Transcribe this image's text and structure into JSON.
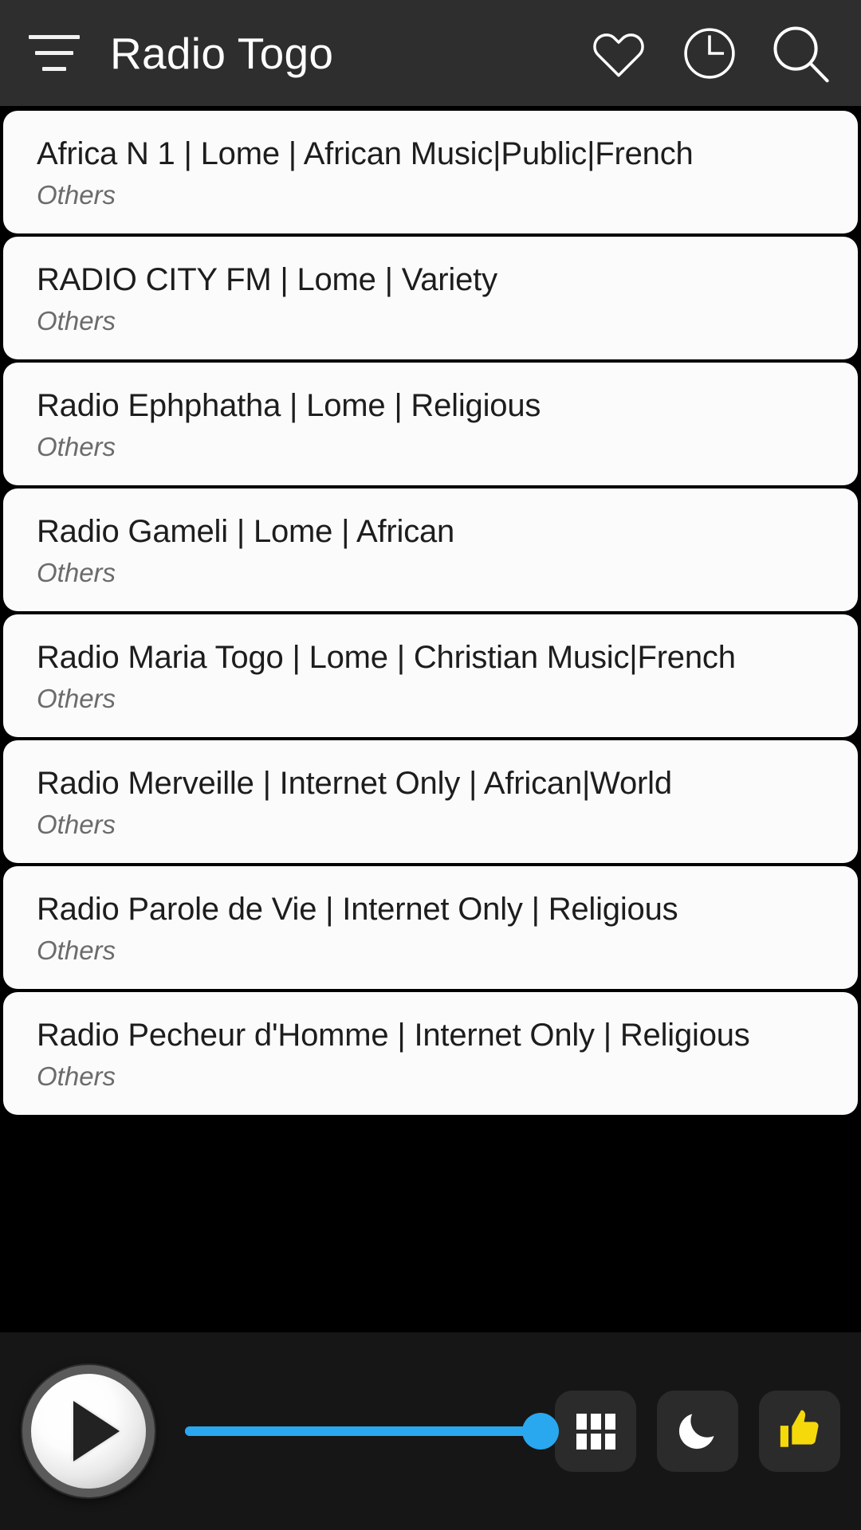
{
  "header": {
    "title": "Radio Togo",
    "menu_icon": "hamburger-menu-icon",
    "actions": [
      {
        "name": "favorites",
        "icon": "heart-icon"
      },
      {
        "name": "recent",
        "icon": "clock-icon"
      },
      {
        "name": "search",
        "icon": "search-icon"
      }
    ]
  },
  "stations": [
    {
      "name": "Africa N 1 | Lome | African Music|Public|French",
      "category": "Others"
    },
    {
      "name": "RADIO CITY FM | Lome | Variety",
      "category": "Others"
    },
    {
      "name": "Radio Ephphatha | Lome | Religious",
      "category": "Others"
    },
    {
      "name": "Radio Gameli | Lome | African",
      "category": "Others"
    },
    {
      "name": "Radio Maria Togo | Lome | Christian Music|French",
      "category": "Others"
    },
    {
      "name": "Radio Merveille | Internet Only | African|World",
      "category": "Others"
    },
    {
      "name": "Radio Parole de Vie | Internet Only | Religious",
      "category": "Others"
    },
    {
      "name": "Radio Pecheur d'Homme | Internet Only | Religious",
      "category": "Others"
    }
  ],
  "player": {
    "play_icon": "play-icon",
    "play_state": "paused",
    "volume": {
      "value": 100,
      "percent": "100%",
      "track_color": "#29a8ef",
      "thumb_color": "#29a8ef"
    },
    "buttons": [
      {
        "name": "equalizer",
        "icon": "grid-icon",
        "color": "#ffffff"
      },
      {
        "name": "sleep-timer",
        "icon": "moon-icon",
        "color": "#ffffff"
      },
      {
        "name": "rate-app",
        "icon": "thumbs-up-icon",
        "color": "#f5d90a"
      }
    ]
  },
  "colors": {
    "appbar_bg": "#2e2e2e",
    "page_bg": "#000000",
    "card_bg": "#fbfbfb",
    "player_bg": "#161616",
    "accent": "#29a8ef",
    "like_yellow": "#f5d90a"
  }
}
